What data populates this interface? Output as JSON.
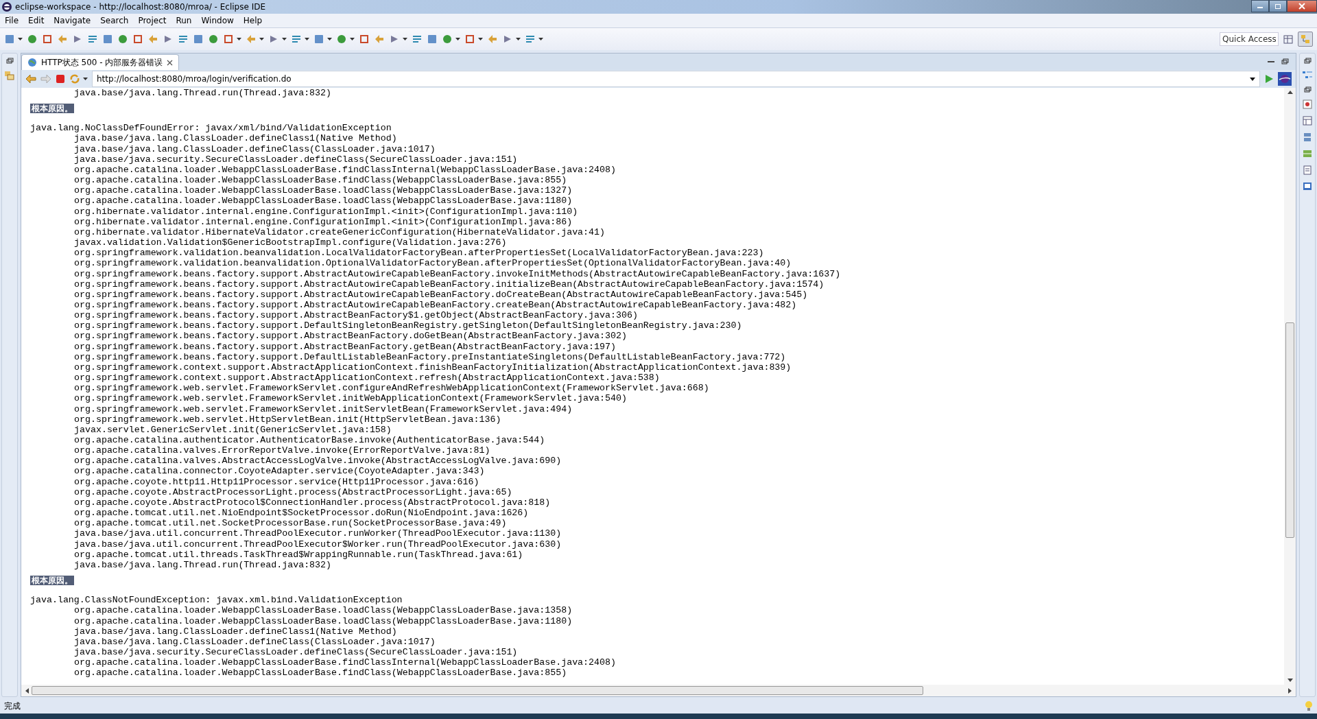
{
  "window": {
    "title": "eclipse-workspace - http://localhost:8080/mroa/ - Eclipse IDE"
  },
  "menu": [
    "File",
    "Edit",
    "Navigate",
    "Search",
    "Project",
    "Run",
    "Window",
    "Help"
  ],
  "quick_access": {
    "placeholder": "Quick Access"
  },
  "editor_tab": {
    "label": "HTTP状态 500 - 内部服务器错误",
    "selected": true
  },
  "address_bar": {
    "value": "http://localhost:8080/mroa/login/verification.do"
  },
  "page": {
    "leading_frames": [
      "java.base/java.lang.Thread.run(Thread.java:832)"
    ],
    "root_causes": [
      {
        "heading": "根本原因。",
        "exception": "java.lang.NoClassDefFoundError: javax/xml/bind/ValidationException",
        "frames": [
          "java.base/java.lang.ClassLoader.defineClass1(Native Method)",
          "java.base/java.lang.ClassLoader.defineClass(ClassLoader.java:1017)",
          "java.base/java.security.SecureClassLoader.defineClass(SecureClassLoader.java:151)",
          "org.apache.catalina.loader.WebappClassLoaderBase.findClassInternal(WebappClassLoaderBase.java:2408)",
          "org.apache.catalina.loader.WebappClassLoaderBase.findClass(WebappClassLoaderBase.java:855)",
          "org.apache.catalina.loader.WebappClassLoaderBase.loadClass(WebappClassLoaderBase.java:1327)",
          "org.apache.catalina.loader.WebappClassLoaderBase.loadClass(WebappClassLoaderBase.java:1180)",
          "org.hibernate.validator.internal.engine.ConfigurationImpl.<init>(ConfigurationImpl.java:110)",
          "org.hibernate.validator.internal.engine.ConfigurationImpl.<init>(ConfigurationImpl.java:86)",
          "org.hibernate.validator.HibernateValidator.createGenericConfiguration(HibernateValidator.java:41)",
          "javax.validation.Validation$GenericBootstrapImpl.configure(Validation.java:276)",
          "org.springframework.validation.beanvalidation.LocalValidatorFactoryBean.afterPropertiesSet(LocalValidatorFactoryBean.java:223)",
          "org.springframework.validation.beanvalidation.OptionalValidatorFactoryBean.afterPropertiesSet(OptionalValidatorFactoryBean.java:40)",
          "org.springframework.beans.factory.support.AbstractAutowireCapableBeanFactory.invokeInitMethods(AbstractAutowireCapableBeanFactory.java:1637)",
          "org.springframework.beans.factory.support.AbstractAutowireCapableBeanFactory.initializeBean(AbstractAutowireCapableBeanFactory.java:1574)",
          "org.springframework.beans.factory.support.AbstractAutowireCapableBeanFactory.doCreateBean(AbstractAutowireCapableBeanFactory.java:545)",
          "org.springframework.beans.factory.support.AbstractAutowireCapableBeanFactory.createBean(AbstractAutowireCapableBeanFactory.java:482)",
          "org.springframework.beans.factory.support.AbstractBeanFactory$1.getObject(AbstractBeanFactory.java:306)",
          "org.springframework.beans.factory.support.DefaultSingletonBeanRegistry.getSingleton(DefaultSingletonBeanRegistry.java:230)",
          "org.springframework.beans.factory.support.AbstractBeanFactory.doGetBean(AbstractBeanFactory.java:302)",
          "org.springframework.beans.factory.support.AbstractBeanFactory.getBean(AbstractBeanFactory.java:197)",
          "org.springframework.beans.factory.support.DefaultListableBeanFactory.preInstantiateSingletons(DefaultListableBeanFactory.java:772)",
          "org.springframework.context.support.AbstractApplicationContext.finishBeanFactoryInitialization(AbstractApplicationContext.java:839)",
          "org.springframework.context.support.AbstractApplicationContext.refresh(AbstractApplicationContext.java:538)",
          "org.springframework.web.servlet.FrameworkServlet.configureAndRefreshWebApplicationContext(FrameworkServlet.java:668)",
          "org.springframework.web.servlet.FrameworkServlet.initWebApplicationContext(FrameworkServlet.java:540)",
          "org.springframework.web.servlet.FrameworkServlet.initServletBean(FrameworkServlet.java:494)",
          "org.springframework.web.servlet.HttpServletBean.init(HttpServletBean.java:136)",
          "javax.servlet.GenericServlet.init(GenericServlet.java:158)",
          "org.apache.catalina.authenticator.AuthenticatorBase.invoke(AuthenticatorBase.java:544)",
          "org.apache.catalina.valves.ErrorReportValve.invoke(ErrorReportValve.java:81)",
          "org.apache.catalina.valves.AbstractAccessLogValve.invoke(AbstractAccessLogValve.java:690)",
          "org.apache.catalina.connector.CoyoteAdapter.service(CoyoteAdapter.java:343)",
          "org.apache.coyote.http11.Http11Processor.service(Http11Processor.java:616)",
          "org.apache.coyote.AbstractProcessorLight.process(AbstractProcessorLight.java:65)",
          "org.apache.coyote.AbstractProtocol$ConnectionHandler.process(AbstractProtocol.java:818)",
          "org.apache.tomcat.util.net.NioEndpoint$SocketProcessor.doRun(NioEndpoint.java:1626)",
          "org.apache.tomcat.util.net.SocketProcessorBase.run(SocketProcessorBase.java:49)",
          "java.base/java.util.concurrent.ThreadPoolExecutor.runWorker(ThreadPoolExecutor.java:1130)",
          "java.base/java.util.concurrent.ThreadPoolExecutor$Worker.run(ThreadPoolExecutor.java:630)",
          "org.apache.tomcat.util.threads.TaskThread$WrappingRunnable.run(TaskThread.java:61)",
          "java.base/java.lang.Thread.run(Thread.java:832)"
        ]
      },
      {
        "heading": "根本原因。",
        "exception": "java.lang.ClassNotFoundException: javax.xml.bind.ValidationException",
        "frames": [
          "org.apache.catalina.loader.WebappClassLoaderBase.loadClass(WebappClassLoaderBase.java:1358)",
          "org.apache.catalina.loader.WebappClassLoaderBase.loadClass(WebappClassLoaderBase.java:1180)",
          "java.base/java.lang.ClassLoader.defineClass1(Native Method)",
          "java.base/java.lang.ClassLoader.defineClass(ClassLoader.java:1017)",
          "java.base/java.security.SecureClassLoader.defineClass(SecureClassLoader.java:151)",
          "org.apache.catalina.loader.WebappClassLoaderBase.findClassInternal(WebappClassLoaderBase.java:2408)",
          "org.apache.catalina.loader.WebappClassLoaderBase.findClass(WebappClassLoaderBase.java:855)"
        ]
      }
    ]
  },
  "status_bar": {
    "text": "完成"
  }
}
